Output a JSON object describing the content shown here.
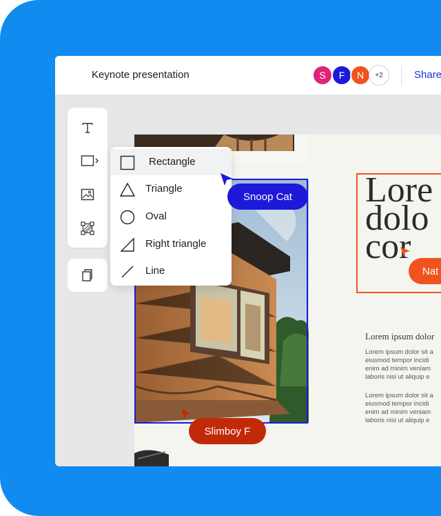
{
  "header": {
    "title": "Keynote presentation",
    "avatars": [
      {
        "letter": "S",
        "color": "#e0237a"
      },
      {
        "letter": "F",
        "color": "#1d19d9"
      },
      {
        "letter": "N",
        "color": "#f0531e"
      }
    ],
    "more_count": "+2",
    "share_label": "Share"
  },
  "toolbar": {
    "tools": [
      "text-tool-icon",
      "shape-tool-icon",
      "image-tool-icon",
      "transform-tool-icon"
    ],
    "secondary_tool": "pages-icon"
  },
  "shape_menu": {
    "items": [
      {
        "label": "Rectangle",
        "icon": "rectangle-icon",
        "active": true
      },
      {
        "label": "Triangle",
        "icon": "triangle-icon"
      },
      {
        "label": "Oval",
        "icon": "oval-icon"
      },
      {
        "label": "Right triangle",
        "icon": "right-triangle-icon"
      },
      {
        "label": "Line",
        "icon": "line-icon"
      }
    ]
  },
  "cursors": {
    "snoop": {
      "label": "Snoop Cat",
      "color": "#1d19d9"
    },
    "slimboy": {
      "label": "Slimboy F",
      "color": "#c12a08"
    },
    "nat": {
      "label": "Nat",
      "color": "#f0531e"
    }
  },
  "slide": {
    "big_lines": "Lore\ndolo\ncor",
    "heading": "Lorem ipsum dolor",
    "para1": "Lorem ipsum dolor sit a\neiusmod tempor incidi\nenim ad minim veniam\nlaboris nisi ut aliquip e",
    "para2": "Lorem ipsum dolor sit a\neiusmod tempor incidi\nenim ad minim veniam\nlaboris nisi ut aliquip e"
  },
  "colors": {
    "brand_blue": "#118bf0",
    "share_blue": "#1a2ee0",
    "accent_orange": "#f0531e"
  }
}
